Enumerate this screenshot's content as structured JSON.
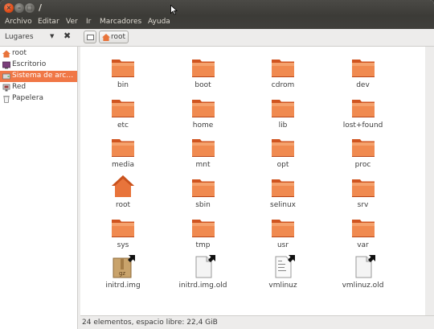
{
  "window": {
    "title": "/"
  },
  "menu": [
    "Archivo",
    "Editar",
    "Ver",
    "Ir",
    "Marcadores",
    "Ayuda"
  ],
  "toolbar": {
    "places_label": "Lugares",
    "breadcrumb": "root"
  },
  "sidebar": [
    {
      "label": "root",
      "icon": "home-icon",
      "selected": false
    },
    {
      "label": "Escritorio",
      "icon": "desktop-icon",
      "selected": false
    },
    {
      "label": "Sistema de arc…",
      "icon": "filesystem-icon",
      "selected": true
    },
    {
      "label": "Red",
      "icon": "network-icon",
      "selected": false
    },
    {
      "label": "Papelera",
      "icon": "trash-icon",
      "selected": false
    }
  ],
  "files": [
    {
      "name": "bin",
      "kind": "folder"
    },
    {
      "name": "boot",
      "kind": "folder"
    },
    {
      "name": "cdrom",
      "kind": "folder"
    },
    {
      "name": "dev",
      "kind": "folder"
    },
    {
      "name": "etc",
      "kind": "folder"
    },
    {
      "name": "home",
      "kind": "folder"
    },
    {
      "name": "lib",
      "kind": "folder"
    },
    {
      "name": "lost+found",
      "kind": "folder"
    },
    {
      "name": "media",
      "kind": "folder"
    },
    {
      "name": "mnt",
      "kind": "folder"
    },
    {
      "name": "opt",
      "kind": "folder"
    },
    {
      "name": "proc",
      "kind": "folder"
    },
    {
      "name": "root",
      "kind": "home"
    },
    {
      "name": "sbin",
      "kind": "folder"
    },
    {
      "name": "selinux",
      "kind": "folder"
    },
    {
      "name": "srv",
      "kind": "folder"
    },
    {
      "name": "sys",
      "kind": "folder"
    },
    {
      "name": "tmp",
      "kind": "folder"
    },
    {
      "name": "usr",
      "kind": "folder"
    },
    {
      "name": "var",
      "kind": "folder"
    },
    {
      "name": "initrd.img",
      "kind": "archive-link",
      "badge": "gz"
    },
    {
      "name": "initrd.img.old",
      "kind": "file-link"
    },
    {
      "name": "vmlinuz",
      "kind": "text-link"
    },
    {
      "name": "vmlinuz.old",
      "kind": "file-link"
    }
  ],
  "status": "24 elementos, espacio libre: 22,4 GiB",
  "colors": {
    "accent": "#f07746",
    "folder": "#e8743b",
    "titlebar": "#3c3b37"
  }
}
